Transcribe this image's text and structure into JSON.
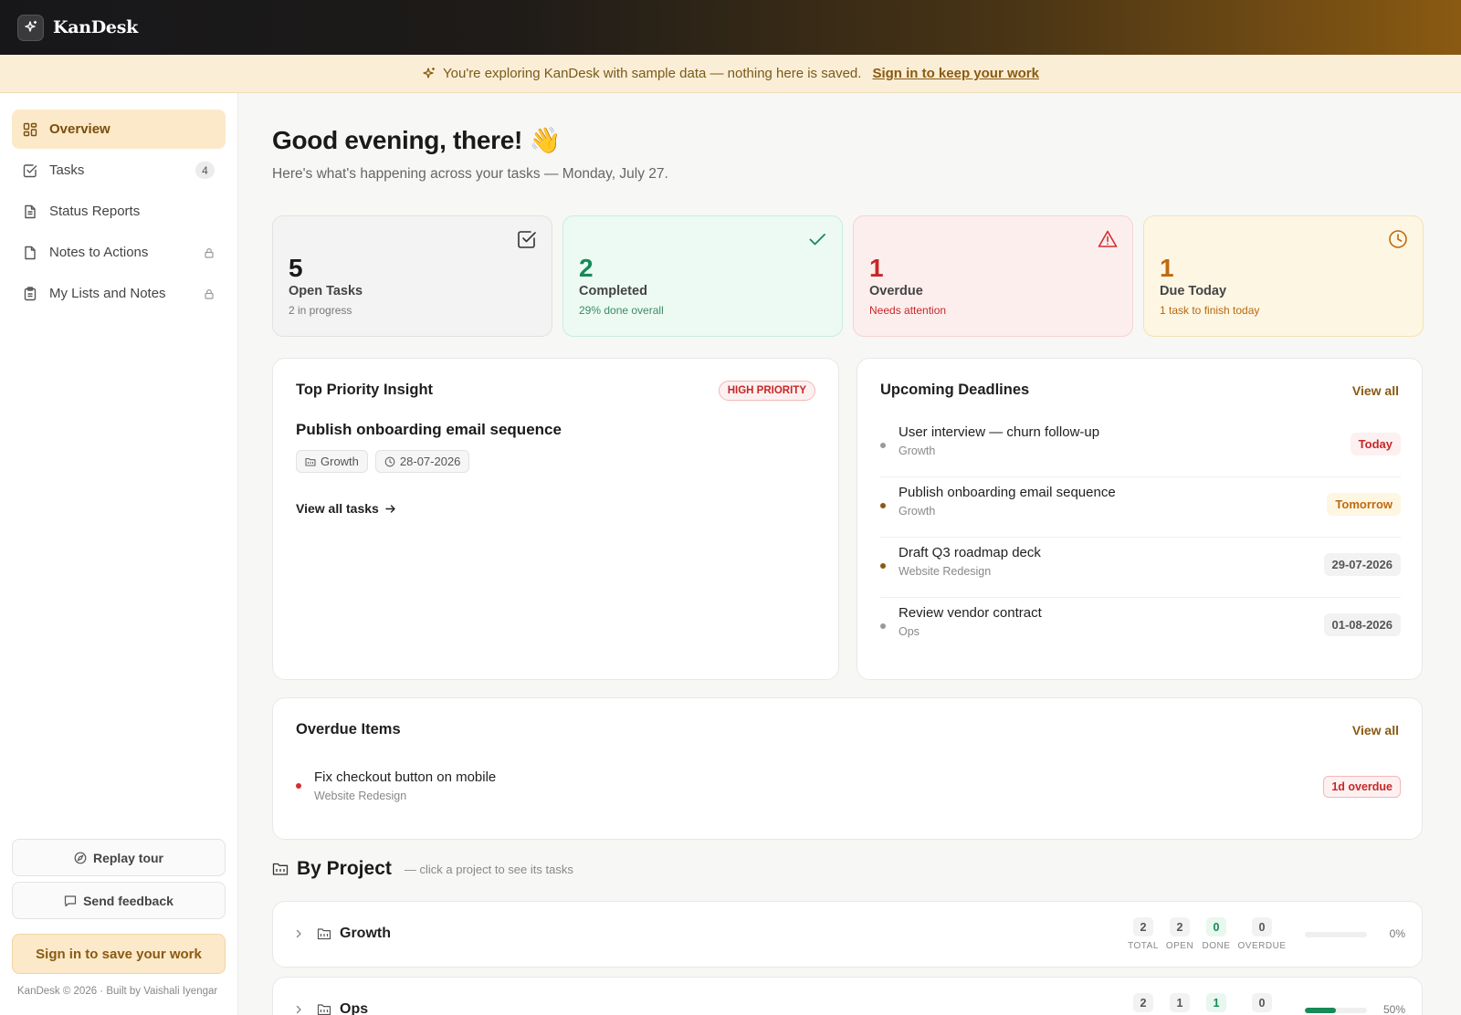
{
  "app": {
    "name": "KanDesk"
  },
  "banner": {
    "text": "You're exploring KanDesk with sample data — nothing here is saved.",
    "link": "Sign in to keep your work"
  },
  "sidebar": {
    "items": [
      {
        "label": "Overview",
        "icon": "grid-icon",
        "active": true
      },
      {
        "label": "Tasks",
        "icon": "checkbox-icon",
        "badge": "4"
      },
      {
        "label": "Status Reports",
        "icon": "document-icon"
      },
      {
        "label": "Notes to Actions",
        "icon": "file-icon",
        "locked": true
      },
      {
        "label": "My Lists and Notes",
        "icon": "clipboard-icon",
        "locked": true
      }
    ],
    "replay_tour": "Replay tour",
    "send_feedback": "Send feedback",
    "sign_in": "Sign in to save your work",
    "footer": "KanDesk © 2026 · Built by Vaishali Iyengar"
  },
  "greeting": {
    "title": "Good evening, there! 👋",
    "subtitle": "Here's what's happening across your tasks — Monday, July 27."
  },
  "stats": [
    {
      "value": "5",
      "title": "Open Tasks",
      "sub": "2 in progress",
      "icon": "checkbox-icon"
    },
    {
      "value": "2",
      "title": "Completed",
      "sub": "29% done overall",
      "icon": "check-icon"
    },
    {
      "value": "1",
      "title": "Overdue",
      "sub": "Needs attention",
      "icon": "warning-icon"
    },
    {
      "value": "1",
      "title": "Due Today",
      "sub": "1 task to finish today",
      "icon": "clock-icon"
    }
  ],
  "insight": {
    "title": "Top Priority Insight",
    "badge": "HIGH PRIORITY",
    "task": "Publish onboarding email sequence",
    "project": "Growth",
    "date": "28-07-2026",
    "link": "View all tasks"
  },
  "deadlines": {
    "title": "Upcoming Deadlines",
    "view_all": "View all",
    "items": [
      {
        "name": "User interview — churn follow-up",
        "project": "Growth",
        "due": "Today",
        "dot": "#9a9a9a"
      },
      {
        "name": "Publish onboarding email sequence",
        "project": "Growth",
        "due": "Tomorrow",
        "dot": "#8a5a12"
      },
      {
        "name": "Draft Q3 roadmap deck",
        "project": "Website Redesign",
        "due": "29-07-2026",
        "dot": "#8a5a12"
      },
      {
        "name": "Review vendor contract",
        "project": "Ops",
        "due": "01-08-2026",
        "dot": "#9a9a9a"
      }
    ]
  },
  "overdue": {
    "title": "Overdue Items",
    "view_all": "View all",
    "items": [
      {
        "name": "Fix checkout button on mobile",
        "project": "Website Redesign",
        "badge": "1d overdue"
      }
    ]
  },
  "by_project": {
    "title": "By Project",
    "hint": "— click a project to see its tasks",
    "metric_labels": {
      "total": "TOTAL",
      "open": "OPEN",
      "done": "DONE",
      "overdue": "OVERDUE"
    },
    "projects": [
      {
        "name": "Growth",
        "total": "2",
        "open": "2",
        "done": "0",
        "overdue": "0",
        "progress": 0,
        "pct": "0%"
      },
      {
        "name": "Ops",
        "total": "2",
        "open": "1",
        "done": "1",
        "overdue": "0",
        "progress": 50,
        "pct": "50%"
      }
    ]
  },
  "colors": {
    "accent": "#8a5a12",
    "success": "#178a56",
    "danger": "#c62828",
    "warning": "#c06a0f"
  }
}
